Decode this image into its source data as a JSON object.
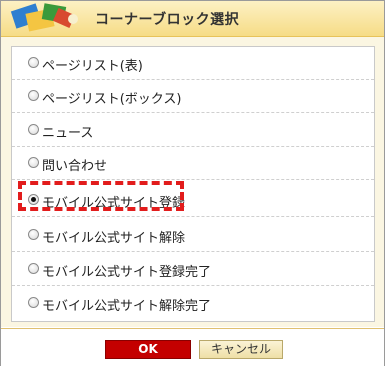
{
  "dialog": {
    "title": "コーナーブロック選択",
    "options": [
      {
        "label": "ページリスト(表)",
        "checked": false
      },
      {
        "label": "ページリスト(ボックス)",
        "checked": false
      },
      {
        "label": "ニュース",
        "checked": false
      },
      {
        "label": "問い合わせ",
        "checked": false
      },
      {
        "label": "モバイル公式サイト登録",
        "checked": true
      },
      {
        "label": "モバイル公式サイト解除",
        "checked": false
      },
      {
        "label": "モバイル公式サイト登録完了",
        "checked": false
      },
      {
        "label": "モバイル公式サイト解除完了",
        "checked": false
      }
    ],
    "ok_label": "OK",
    "cancel_label": "キャンセル"
  },
  "colors": {
    "accent_red": "#c40000",
    "highlight": "#e21c1c",
    "title_gradient_top": "#fdf1c4",
    "title_gradient_bottom": "#f6dc86"
  }
}
